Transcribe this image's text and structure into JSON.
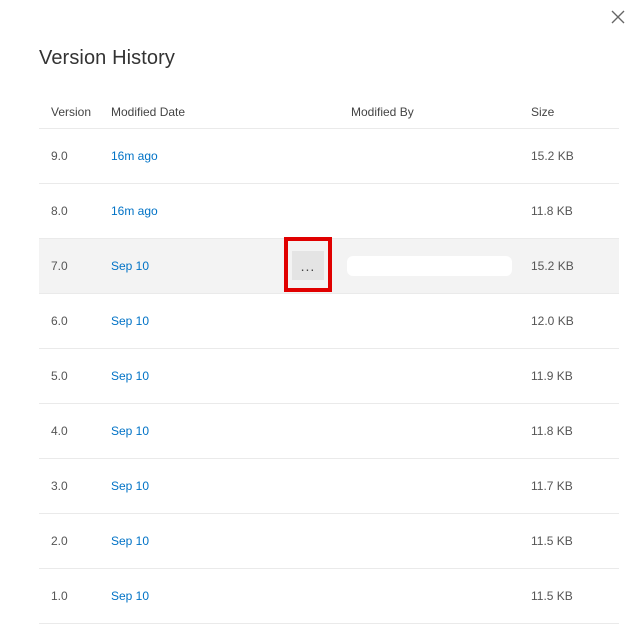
{
  "dialog": {
    "title": "Version History",
    "close_icon": "close-icon"
  },
  "table": {
    "columns": {
      "version": "Version",
      "modified_date": "Modified Date",
      "modified_by": "Modified By",
      "size": "Size"
    },
    "rows": [
      {
        "version": "9.0",
        "modified_date": "16m ago",
        "modified_by": "",
        "size": "15.2 KB"
      },
      {
        "version": "8.0",
        "modified_date": "16m ago",
        "modified_by": "",
        "size": "11.8 KB"
      },
      {
        "version": "7.0",
        "modified_date": "Sep 10",
        "modified_by": "",
        "size": "15.2 KB",
        "selected": true,
        "more_label": "..."
      },
      {
        "version": "6.0",
        "modified_date": "Sep 10",
        "modified_by": "",
        "size": "12.0 KB"
      },
      {
        "version": "5.0",
        "modified_date": "Sep 10",
        "modified_by": "",
        "size": "11.9 KB"
      },
      {
        "version": "4.0",
        "modified_date": "Sep 10",
        "modified_by": "",
        "size": "11.8 KB"
      },
      {
        "version": "3.0",
        "modified_date": "Sep 10",
        "modified_by": "",
        "size": "11.7 KB"
      },
      {
        "version": "2.0",
        "modified_date": "Sep 10",
        "modified_by": "",
        "size": "11.5 KB"
      },
      {
        "version": "1.0",
        "modified_date": "Sep 10",
        "modified_by": "",
        "size": "11.5 KB"
      }
    ]
  },
  "colors": {
    "link": "#0072c6",
    "selected_row": "#f3f3f3",
    "highlight": "#e00000"
  }
}
